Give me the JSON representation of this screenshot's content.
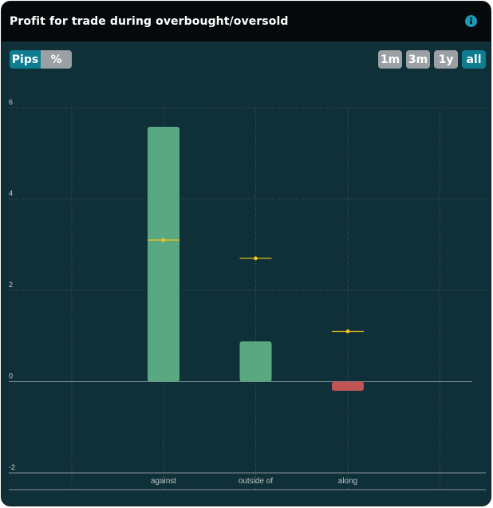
{
  "header": {
    "title": "Profit for trade during overbought/oversold",
    "info_icon": "info-icon"
  },
  "unit_toggle": [
    {
      "label": "Pips",
      "active": true
    },
    {
      "label": "%",
      "active": false
    }
  ],
  "range_buttons": [
    {
      "label": "1m",
      "active": false
    },
    {
      "label": "3m",
      "active": false
    },
    {
      "label": "1y",
      "active": false
    },
    {
      "label": "all",
      "active": true
    }
  ],
  "colors": {
    "positive_bar": "#5aa882",
    "negative_bar": "#c25456",
    "marker": "#f5c518",
    "background": "#0f3038",
    "active_button": "#0e7d92"
  },
  "chart_data": {
    "type": "bar",
    "categories": [
      "against",
      "outside of",
      "along"
    ],
    "values": [
      5.58,
      0.88,
      -0.2
    ],
    "markers": [
      3.1,
      2.7,
      1.1
    ],
    "ylim": [
      -2,
      6
    ],
    "yticks": [
      -2,
      0,
      2,
      4,
      6
    ],
    "grid": true
  }
}
